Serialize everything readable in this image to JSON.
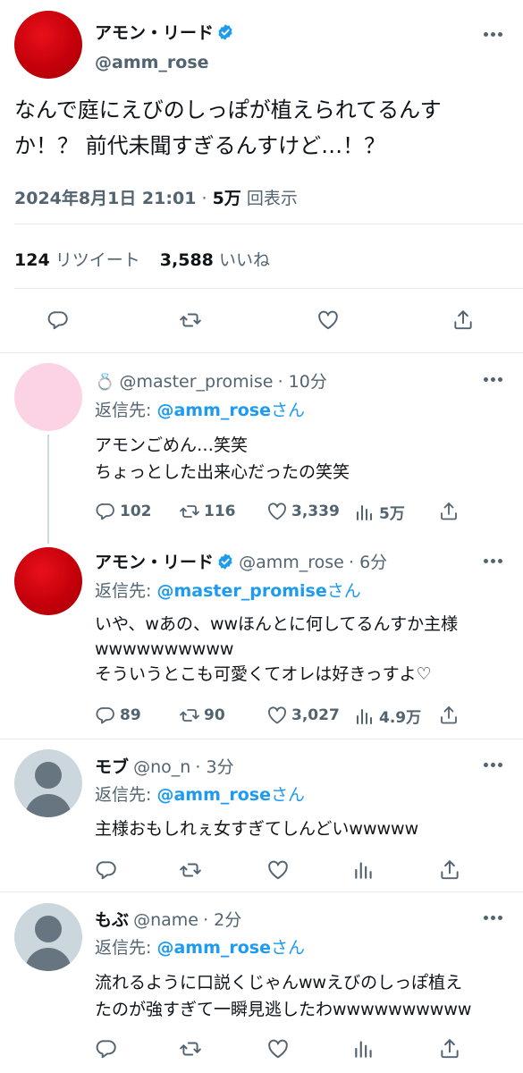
{
  "main_tweet": {
    "author_name": "アモン・リード",
    "author_handle": "@amm_rose",
    "text_line1": "なんで庭にえびのしっぽが植えられてるんす",
    "text_line2": "か！？ 前代未聞すぎるんすけど…！？",
    "timestamp": "2024年8月1日 21:01",
    "separator": "·",
    "views_count": "5万",
    "views_label": "回表示",
    "retweets_count": "124",
    "retweets_label": "リツイート",
    "likes_count": "3,588",
    "likes_label": "いいね"
  },
  "replies": [
    {
      "emoji": "💍",
      "author_name": "",
      "author_handle": "@master_promise",
      "time": "· 10分",
      "reply_prefix": "返信先: ",
      "reply_to": "@amm_rose",
      "reply_suffix": "さん",
      "lines": [
        "アモンごめん…笑笑",
        "ちょっとした出来心だったの笑笑"
      ],
      "replies": "102",
      "retweets": "116",
      "likes": "3,339",
      "views": "5万"
    },
    {
      "author_name": "アモン・リード",
      "author_handle": "@amm_rose",
      "time": "· 6分",
      "reply_prefix": "返信先: ",
      "reply_to": "@master_promise",
      "reply_suffix": "さん",
      "lines": [
        "いや、wあの、wwほんとに何してるんすか主様",
        "wwwwwwwwww",
        "そういうとこも可愛くてオレは好きっすよ♡"
      ],
      "replies": "89",
      "retweets": "90",
      "likes": "3,027",
      "views": "4.9万"
    },
    {
      "author_name": "モブ",
      "author_handle": "@no_n",
      "time": "· 3分",
      "reply_prefix": "返信先: ",
      "reply_to": "@amm_rose",
      "reply_suffix": "さん",
      "lines": [
        "主様おもしれぇ女すぎてしんどいwwwww"
      ]
    },
    {
      "author_name": "もぶ",
      "author_handle": "@name",
      "time": "· 2分",
      "reply_prefix": "返信先: ",
      "reply_to": "@amm_rose",
      "reply_suffix": "さん",
      "lines": [
        "流れるように口説くじゃんwwえびのしっぽ植え",
        "たのが強すぎて一瞬見逃したわwwwwwwwwww"
      ]
    }
  ],
  "colors": {
    "accent": "#1d9bf0",
    "text": "#0f1419",
    "muted": "#536471",
    "avatar_red": "#c4000a",
    "avatar_pink": "#fbd3e5",
    "avatar_default": "#ccd6dd"
  },
  "icons": [
    "verified-badge-icon",
    "more-icon",
    "reply-icon",
    "retweet-icon",
    "like-icon",
    "share-icon",
    "views-icon"
  ]
}
